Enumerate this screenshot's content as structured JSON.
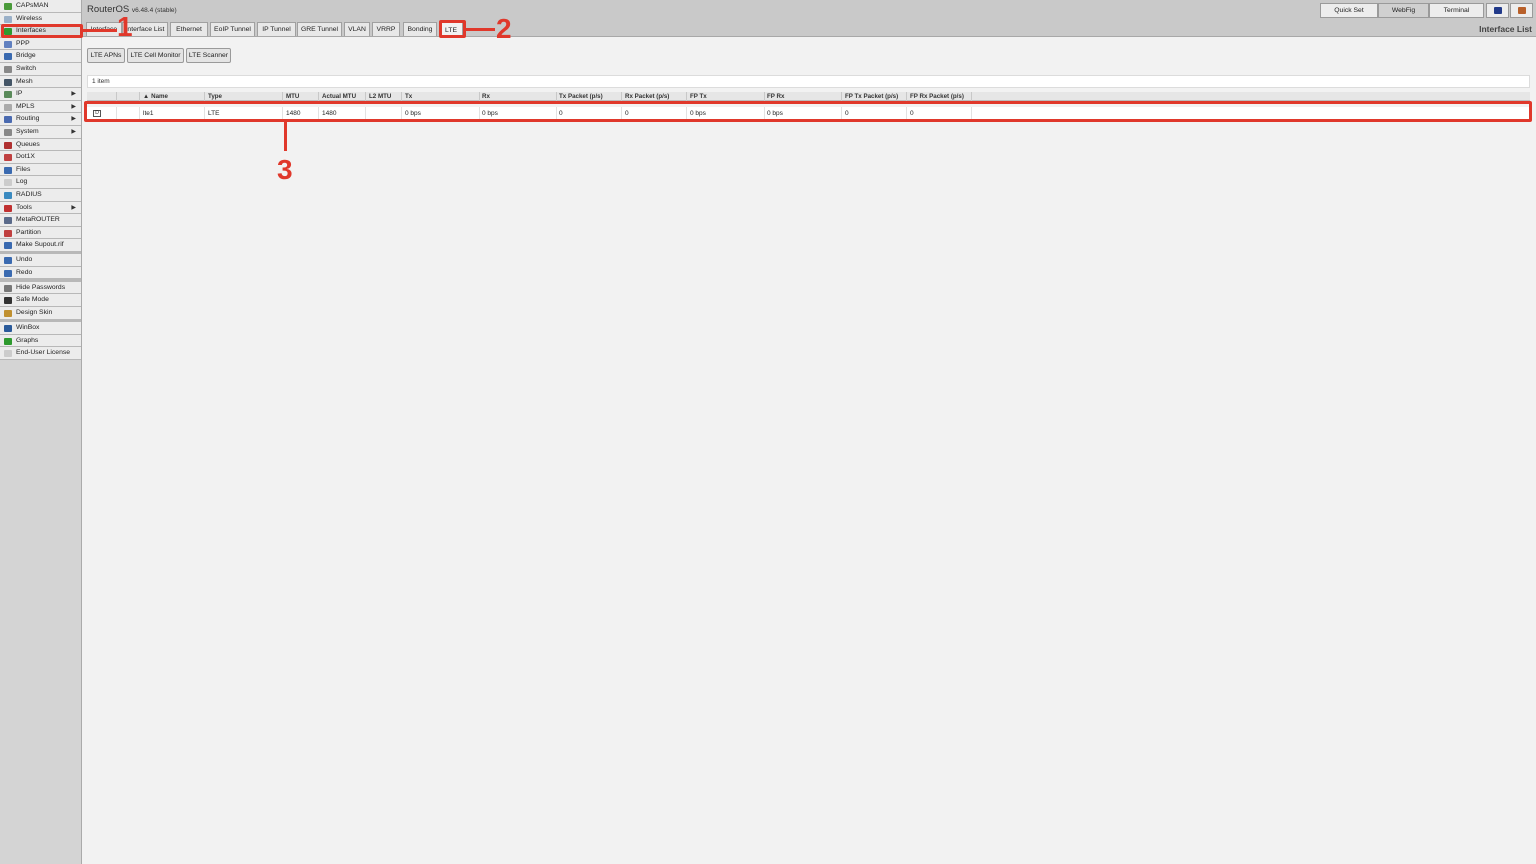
{
  "sidebar": {
    "groups": [
      [
        {
          "label": "CAPsMAN",
          "icon": "capsman-icon",
          "color": "#4a9a3a"
        },
        {
          "label": "Wireless",
          "icon": "wireless-icon",
          "color": "#9ab0c8"
        },
        {
          "label": "Interfaces",
          "icon": "interfaces-icon",
          "color": "#2e9a2e",
          "active": true
        },
        {
          "label": "PPP",
          "icon": "ppp-icon",
          "color": "#6080c0"
        },
        {
          "label": "Bridge",
          "icon": "bridge-icon",
          "color": "#3a6ab0"
        },
        {
          "label": "Switch",
          "icon": "switch-icon",
          "color": "#888888"
        },
        {
          "label": "Mesh",
          "icon": "mesh-icon",
          "color": "#445566"
        },
        {
          "label": "IP",
          "icon": "ip-icon",
          "color": "#5a8a5a",
          "submenu": true
        },
        {
          "label": "MPLS",
          "icon": "mpls-icon",
          "color": "#aaaaaa",
          "submenu": true
        },
        {
          "label": "Routing",
          "icon": "routing-icon",
          "color": "#4a6ab0",
          "submenu": true
        },
        {
          "label": "System",
          "icon": "system-icon",
          "color": "#888888",
          "submenu": true
        },
        {
          "label": "Queues",
          "icon": "queues-icon",
          "color": "#b03030"
        },
        {
          "label": "Dot1X",
          "icon": "dot1x-icon",
          "color": "#c04040"
        },
        {
          "label": "Files",
          "icon": "files-icon",
          "color": "#3a6ab0"
        },
        {
          "label": "Log",
          "icon": "log-icon",
          "color": "#cccccc"
        },
        {
          "label": "RADIUS",
          "icon": "radius-icon",
          "color": "#3a8ac0"
        },
        {
          "label": "Tools",
          "icon": "tools-icon",
          "color": "#c03030",
          "submenu": true
        },
        {
          "label": "MetaROUTER",
          "icon": "metarouter-icon",
          "color": "#5a6a8a"
        },
        {
          "label": "Partition",
          "icon": "partition-icon",
          "color": "#c04040"
        },
        {
          "label": "Make Supout.rif",
          "icon": "supout-icon",
          "color": "#3a6ab0"
        }
      ],
      [
        {
          "label": "Undo",
          "icon": "undo-icon",
          "color": "#3a6ab0"
        },
        {
          "label": "Redo",
          "icon": "redo-icon",
          "color": "#3a6ab0"
        }
      ],
      [
        {
          "label": "Hide Passwords",
          "icon": "hide-passwords-icon",
          "color": "#777777"
        },
        {
          "label": "Safe Mode",
          "icon": "safe-mode-icon",
          "color": "#333333"
        },
        {
          "label": "Design Skin",
          "icon": "design-skin-icon",
          "color": "#c09030"
        }
      ],
      [
        {
          "label": "WinBox",
          "icon": "winbox-icon",
          "color": "#2a5a9a"
        },
        {
          "label": "Graphs",
          "icon": "graphs-icon",
          "color": "#2e9a2e"
        },
        {
          "label": "End-User License",
          "icon": "license-icon",
          "color": "#cccccc"
        }
      ]
    ],
    "submenu_arrow": "▶"
  },
  "header": {
    "brand": "RouterOS",
    "version": "v6.48.4 (stable)",
    "quick_set": "Quick Set",
    "webfig": "WebFig",
    "terminal": "Terminal",
    "page_title": "Interface List"
  },
  "tabs": [
    "Interface",
    "Interface List",
    "Ethernet",
    "EoIP Tunnel",
    "IP Tunnel",
    "GRE Tunnel",
    "VLAN",
    "VRRP",
    "Bonding",
    "LTE"
  ],
  "toolbar": {
    "lte_apns": "LTE APNs",
    "lte_cell_monitor": "LTE Cell Monitor",
    "lte_scanner": "LTE Scanner"
  },
  "table": {
    "count_label": "1 item",
    "sort_marker": "▲",
    "columns": [
      "Name",
      "Type",
      "MTU",
      "Actual MTU",
      "L2 MTU",
      "Tx",
      "Rx",
      "Tx Packet (p/s)",
      "Rx Packet (p/s)",
      "FP Tx",
      "FP Rx",
      "FP Tx Packet (p/s)",
      "FP Rx Packet (p/s)"
    ],
    "rows": [
      {
        "flag": "D",
        "cells": [
          "lte1",
          "LTE",
          "1480",
          "1480",
          "",
          "0 bps",
          "0 bps",
          "0",
          "0",
          "0 bps",
          "0 bps",
          "0",
          "0"
        ]
      }
    ]
  },
  "annotations": [
    "1",
    "2",
    "3"
  ],
  "colors": {
    "annotation": "#e0382b"
  }
}
